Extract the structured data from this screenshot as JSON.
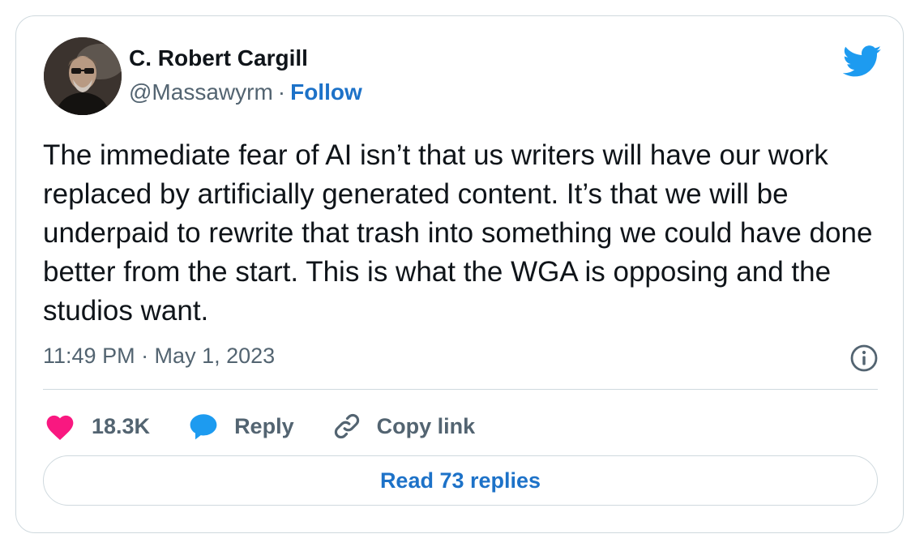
{
  "author": {
    "name": "C. Robert Cargill",
    "handle": "@Massawyrm",
    "separator": "·",
    "follow_label": "Follow"
  },
  "tweet": {
    "text": "The immediate fear of AI isn’t that us writers will have our work replaced by artificially generated content. It’s that we will be underpaid to rewrite that trash into something we could have done better from the start. This is what the WGA is opposing and the studios want.",
    "timestamp": "11:49 PM · May 1, 2023"
  },
  "actions": {
    "likes_count": "18.3K",
    "reply_label": "Reply",
    "copy_link_label": "Copy link"
  },
  "read_replies_label": "Read 73 replies",
  "icons": {
    "brand": "twitter-bird-icon",
    "info": "info-icon",
    "like": "heart-icon",
    "reply": "speech-bubble-icon",
    "copy_link": "link-icon"
  },
  "colors": {
    "twitter_blue": "#1d9bf0",
    "link_blue": "#1d72c8",
    "like_pink": "#f91880",
    "border": "#cfd9de",
    "secondary_text": "#536471"
  }
}
